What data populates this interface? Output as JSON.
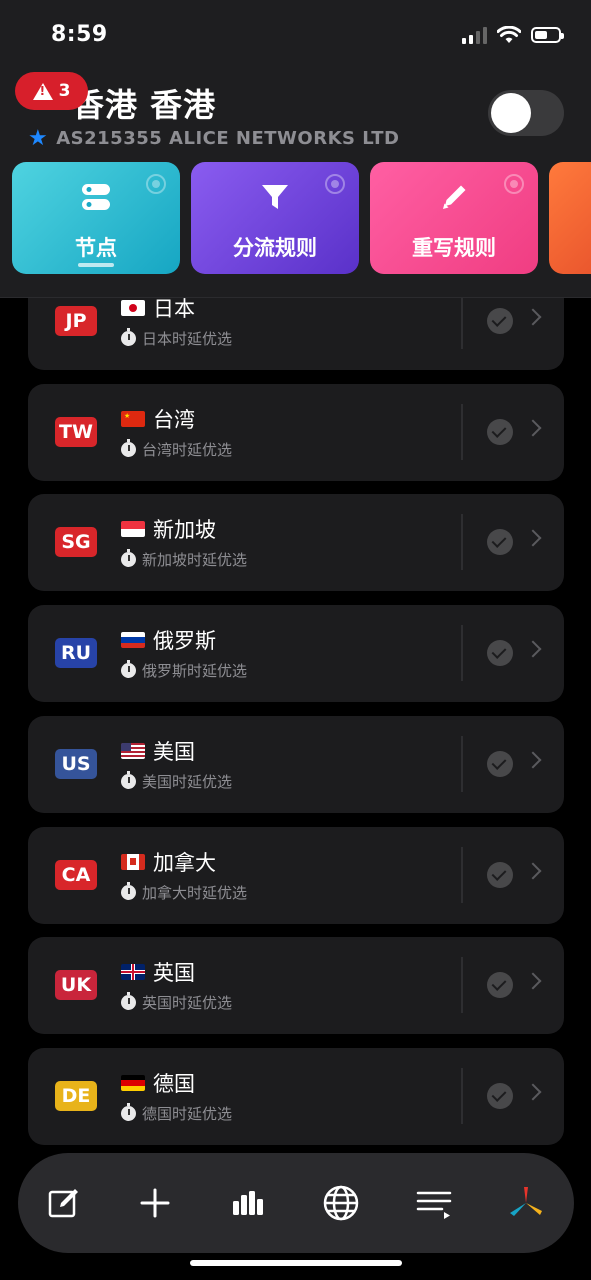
{
  "status_bar": {
    "time": "8:59"
  },
  "header": {
    "alert_count": "3",
    "title": "香港  香港",
    "subtitle": "AS215355 ALICE NETWORKS LTD",
    "toggle_on": false
  },
  "tiles": [
    {
      "label": "节点",
      "icon": "server-icon",
      "selected": true
    },
    {
      "label": "分流规则",
      "icon": "filter-icon",
      "selected": false
    },
    {
      "label": "重写规则",
      "icon": "pencil-icon",
      "selected": false
    },
    {
      "label": "",
      "icon": "partial-tile",
      "selected": false
    }
  ],
  "groups": [
    {
      "code": "JP",
      "code_color": "#d8262a",
      "name": "日本",
      "desc": "日本时延优选",
      "flag": "jp"
    },
    {
      "code": "TW",
      "code_color": "#d8262a",
      "name": "台湾",
      "desc": "台湾时延优选",
      "flag": "cn"
    },
    {
      "code": "SG",
      "code_color": "#d8262a",
      "name": "新加坡",
      "desc": "新加坡时延优选",
      "flag": "sg"
    },
    {
      "code": "RU",
      "code_color": "#2743a8",
      "name": "俄罗斯",
      "desc": "俄罗斯时延优选",
      "flag": "ru"
    },
    {
      "code": "US",
      "code_color": "#35549a",
      "name": "美国",
      "desc": "美国时延优选",
      "flag": "us"
    },
    {
      "code": "CA",
      "code_color": "#d8262a",
      "name": "加拿大",
      "desc": "加拿大时延优选",
      "flag": "ca"
    },
    {
      "code": "UK",
      "code_color": "#c9253b",
      "name": "英国",
      "desc": "英国时延优选",
      "flag": "uk"
    },
    {
      "code": "DE",
      "code_color": "#e8b31a",
      "name": "德国",
      "desc": "德国时延优选",
      "flag": "de"
    }
  ],
  "bottom_bar": [
    {
      "icon": "edit-icon"
    },
    {
      "icon": "plus-icon"
    },
    {
      "icon": "chart-icon"
    },
    {
      "icon": "globe-icon"
    },
    {
      "icon": "list-play-icon"
    },
    {
      "icon": "app-logo-icon"
    }
  ]
}
